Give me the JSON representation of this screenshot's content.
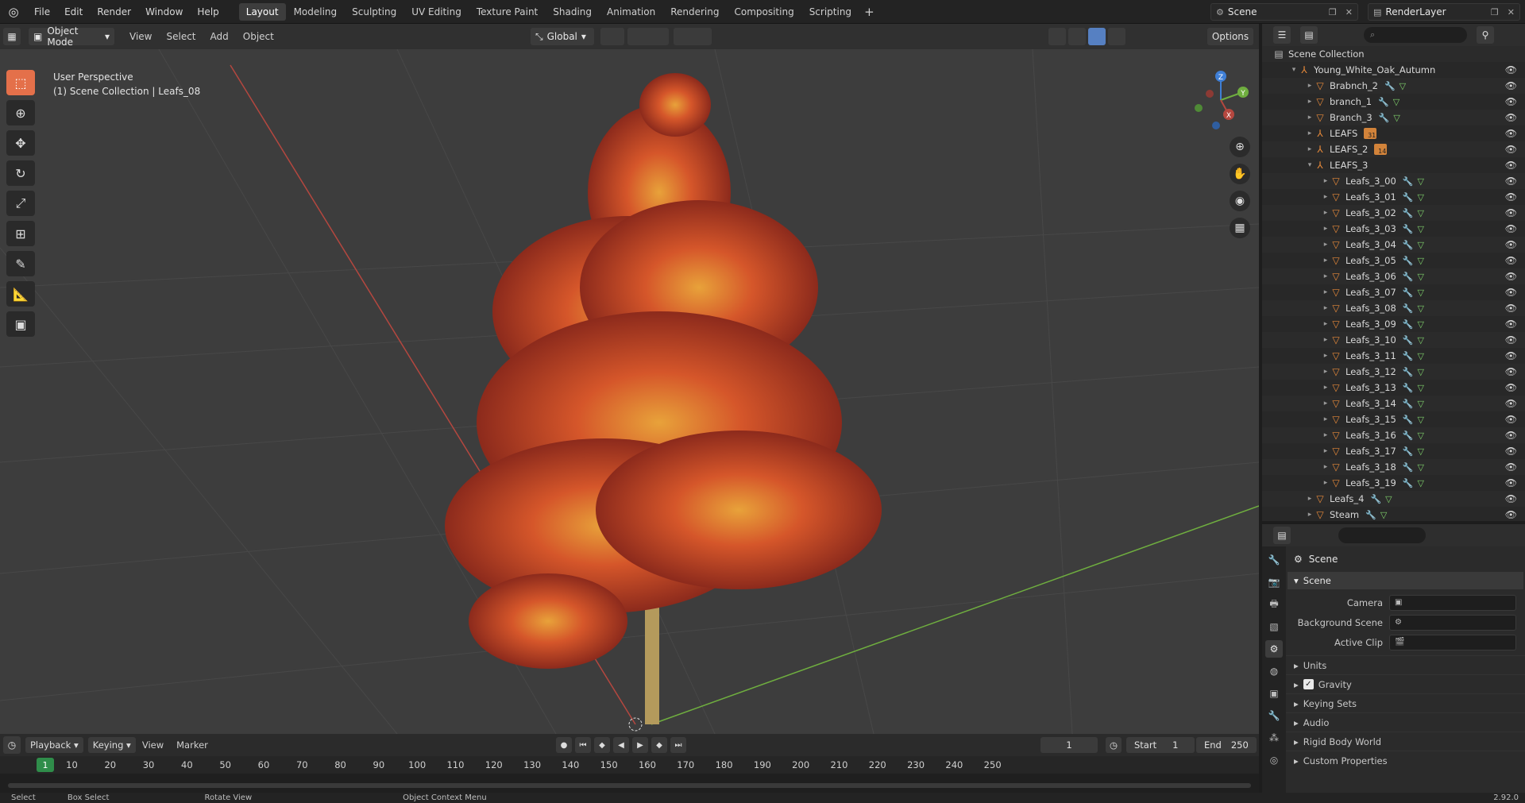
{
  "topbar": {
    "menus": [
      "File",
      "Edit",
      "Render",
      "Window",
      "Help"
    ],
    "workspaces": [
      "Layout",
      "Modeling",
      "Sculpting",
      "UV Editing",
      "Texture Paint",
      "Shading",
      "Animation",
      "Rendering",
      "Compositing",
      "Scripting"
    ],
    "active_workspace": "Layout",
    "add_workspace": "+",
    "scene": "Scene",
    "render_layer": "RenderLayer"
  },
  "viewport_header": {
    "mode": "Object Mode",
    "menus": [
      "View",
      "Select",
      "Add",
      "Object"
    ],
    "orientation": "Global",
    "options": "Options"
  },
  "viewport": {
    "perspective": "User Perspective",
    "context": "(1) Scene Collection | Leafs_08",
    "axes": {
      "x": "X",
      "y": "Y",
      "z": "Z"
    }
  },
  "outliner": {
    "root": "Scene Collection",
    "rows": [
      {
        "name": "Young_White_Oak_Autumn",
        "depth": 1,
        "exp": "▾",
        "type": "empty",
        "mod": false,
        "mesh": false
      },
      {
        "name": "Brabnch_2",
        "depth": 2,
        "exp": "▸",
        "type": "mesh",
        "mod": true,
        "mesh": true
      },
      {
        "name": "branch_1",
        "depth": 2,
        "exp": "▸",
        "type": "mesh",
        "mod": true,
        "mesh": true
      },
      {
        "name": "Branch_3",
        "depth": 2,
        "exp": "▸",
        "type": "mesh",
        "mod": true,
        "mesh": true
      },
      {
        "name": "LEAFS",
        "depth": 2,
        "exp": "▸",
        "type": "empty",
        "badge": "31",
        "mod": false,
        "mesh": false
      },
      {
        "name": "LEAFS_2",
        "depth": 2,
        "exp": "▸",
        "type": "empty",
        "badge": "14",
        "mod": false,
        "mesh": false
      },
      {
        "name": "LEAFS_3",
        "depth": 2,
        "exp": "▾",
        "type": "empty",
        "mod": false,
        "mesh": false
      },
      {
        "name": "Leafs_3_00",
        "depth": 3,
        "exp": "▸",
        "type": "mesh",
        "mod": true,
        "mesh": true
      },
      {
        "name": "Leafs_3_01",
        "depth": 3,
        "exp": "▸",
        "type": "mesh",
        "mod": true,
        "mesh": true
      },
      {
        "name": "Leafs_3_02",
        "depth": 3,
        "exp": "▸",
        "type": "mesh",
        "mod": true,
        "mesh": true
      },
      {
        "name": "Leafs_3_03",
        "depth": 3,
        "exp": "▸",
        "type": "mesh",
        "mod": true,
        "mesh": true
      },
      {
        "name": "Leafs_3_04",
        "depth": 3,
        "exp": "▸",
        "type": "mesh",
        "mod": true,
        "mesh": true
      },
      {
        "name": "Leafs_3_05",
        "depth": 3,
        "exp": "▸",
        "type": "mesh",
        "mod": true,
        "mesh": true
      },
      {
        "name": "Leafs_3_06",
        "depth": 3,
        "exp": "▸",
        "type": "mesh",
        "mod": true,
        "mesh": true
      },
      {
        "name": "Leafs_3_07",
        "depth": 3,
        "exp": "▸",
        "type": "mesh",
        "mod": true,
        "mesh": true
      },
      {
        "name": "Leafs_3_08",
        "depth": 3,
        "exp": "▸",
        "type": "mesh",
        "mod": true,
        "mesh": true
      },
      {
        "name": "Leafs_3_09",
        "depth": 3,
        "exp": "▸",
        "type": "mesh",
        "mod": true,
        "mesh": true
      },
      {
        "name": "Leafs_3_10",
        "depth": 3,
        "exp": "▸",
        "type": "mesh",
        "mod": true,
        "mesh": true
      },
      {
        "name": "Leafs_3_11",
        "depth": 3,
        "exp": "▸",
        "type": "mesh",
        "mod": true,
        "mesh": true
      },
      {
        "name": "Leafs_3_12",
        "depth": 3,
        "exp": "▸",
        "type": "mesh",
        "mod": true,
        "mesh": true
      },
      {
        "name": "Leafs_3_13",
        "depth": 3,
        "exp": "▸",
        "type": "mesh",
        "mod": true,
        "mesh": true
      },
      {
        "name": "Leafs_3_14",
        "depth": 3,
        "exp": "▸",
        "type": "mesh",
        "mod": true,
        "mesh": true
      },
      {
        "name": "Leafs_3_15",
        "depth": 3,
        "exp": "▸",
        "type": "mesh",
        "mod": true,
        "mesh": true
      },
      {
        "name": "Leafs_3_16",
        "depth": 3,
        "exp": "▸",
        "type": "mesh",
        "mod": true,
        "mesh": true
      },
      {
        "name": "Leafs_3_17",
        "depth": 3,
        "exp": "▸",
        "type": "mesh",
        "mod": true,
        "mesh": true
      },
      {
        "name": "Leafs_3_18",
        "depth": 3,
        "exp": "▸",
        "type": "mesh",
        "mod": true,
        "mesh": true
      },
      {
        "name": "Leafs_3_19",
        "depth": 3,
        "exp": "▸",
        "type": "mesh",
        "mod": true,
        "mesh": true
      },
      {
        "name": "Leafs_4",
        "depth": 2,
        "exp": "▸",
        "type": "mesh",
        "mod": true,
        "mesh": true
      },
      {
        "name": "Steam",
        "depth": 2,
        "exp": "▸",
        "type": "mesh",
        "mod": true,
        "mesh": true
      }
    ]
  },
  "properties": {
    "title": "Scene",
    "panel": "Scene",
    "fields": [
      {
        "label": "Camera",
        "value": ""
      },
      {
        "label": "Background Scene",
        "value": ""
      },
      {
        "label": "Active Clip",
        "value": ""
      }
    ],
    "subpanels": [
      "Units",
      "Gravity",
      "Keying Sets",
      "Audio",
      "Rigid Body World",
      "Custom Properties"
    ],
    "gravity_checked": true
  },
  "timeline": {
    "menus": [
      "Playback",
      "Keying",
      "View",
      "Marker"
    ],
    "current_frame": "1",
    "start_label": "Start",
    "start": "1",
    "end_label": "End",
    "end": "250",
    "ticks": [
      "10",
      "20",
      "30",
      "40",
      "50",
      "60",
      "70",
      "80",
      "90",
      "100",
      "110",
      "120",
      "130",
      "140",
      "150",
      "160",
      "170",
      "180",
      "190",
      "200",
      "210",
      "220",
      "230",
      "240",
      "250"
    ]
  },
  "statusbar": {
    "items": [
      "Select",
      "Box Select",
      "Rotate View",
      "Object Context Menu"
    ],
    "version": "2.92.0"
  },
  "colors": {
    "accent": "#e4704a",
    "x_axis": "#b4473f",
    "y_axis": "#6fae3f",
    "z_axis": "#3f7fd6",
    "frame": "#2f8d4a"
  }
}
